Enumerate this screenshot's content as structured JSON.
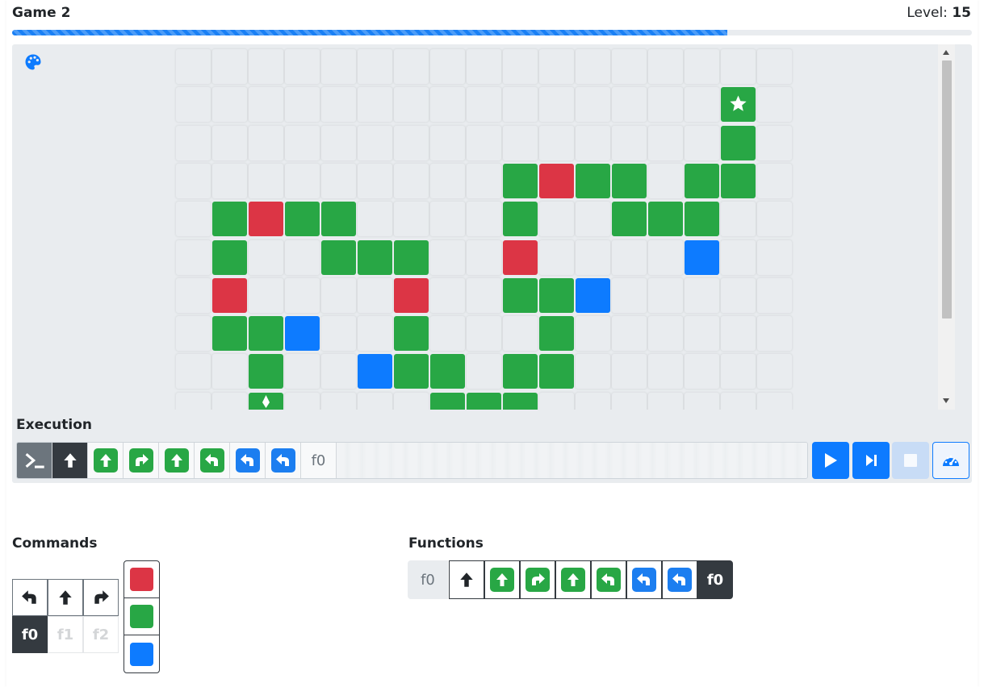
{
  "header": {
    "title": "Game 2",
    "level_label": "Level:",
    "level_value": "15"
  },
  "progress": {
    "fraction": 0.745,
    "color": "#1a80f5"
  },
  "colors": {
    "red": "#dc3545",
    "green": "#28a745",
    "blue": "#0d7bff",
    "empty": "#e9ecef"
  },
  "board": {
    "cols": 17,
    "rows": 10,
    "colored_tiles": [
      {
        "r": 1,
        "c": 15,
        "color": "green",
        "icon": "star"
      },
      {
        "r": 2,
        "c": 15,
        "color": "green"
      },
      {
        "r": 3,
        "c": 9,
        "color": "green"
      },
      {
        "r": 3,
        "c": 10,
        "color": "red"
      },
      {
        "r": 3,
        "c": 11,
        "color": "green"
      },
      {
        "r": 3,
        "c": 12,
        "color": "green"
      },
      {
        "r": 3,
        "c": 14,
        "color": "green"
      },
      {
        "r": 3,
        "c": 15,
        "color": "green"
      },
      {
        "r": 4,
        "c": 1,
        "color": "green"
      },
      {
        "r": 4,
        "c": 2,
        "color": "red"
      },
      {
        "r": 4,
        "c": 3,
        "color": "green"
      },
      {
        "r": 4,
        "c": 4,
        "color": "green"
      },
      {
        "r": 4,
        "c": 9,
        "color": "green"
      },
      {
        "r": 4,
        "c": 12,
        "color": "green"
      },
      {
        "r": 4,
        "c": 13,
        "color": "green"
      },
      {
        "r": 4,
        "c": 14,
        "color": "green"
      },
      {
        "r": 5,
        "c": 1,
        "color": "green"
      },
      {
        "r": 5,
        "c": 4,
        "color": "green"
      },
      {
        "r": 5,
        "c": 5,
        "color": "green"
      },
      {
        "r": 5,
        "c": 6,
        "color": "green"
      },
      {
        "r": 5,
        "c": 9,
        "color": "red"
      },
      {
        "r": 5,
        "c": 14,
        "color": "blue"
      },
      {
        "r": 6,
        "c": 1,
        "color": "red"
      },
      {
        "r": 6,
        "c": 6,
        "color": "red"
      },
      {
        "r": 6,
        "c": 9,
        "color": "green"
      },
      {
        "r": 6,
        "c": 10,
        "color": "green"
      },
      {
        "r": 6,
        "c": 11,
        "color": "blue"
      },
      {
        "r": 7,
        "c": 1,
        "color": "green"
      },
      {
        "r": 7,
        "c": 2,
        "color": "green"
      },
      {
        "r": 7,
        "c": 3,
        "color": "blue"
      },
      {
        "r": 7,
        "c": 6,
        "color": "green"
      },
      {
        "r": 7,
        "c": 10,
        "color": "green"
      },
      {
        "r": 8,
        "c": 2,
        "color": "green"
      },
      {
        "r": 8,
        "c": 5,
        "color": "blue"
      },
      {
        "r": 8,
        "c": 6,
        "color": "green"
      },
      {
        "r": 8,
        "c": 7,
        "color": "green"
      },
      {
        "r": 8,
        "c": 9,
        "color": "green"
      },
      {
        "r": 8,
        "c": 10,
        "color": "green"
      },
      {
        "r": 9,
        "c": 2,
        "color": "green",
        "icon": "robot-arrow"
      },
      {
        "r": 9,
        "c": 7,
        "color": "green"
      },
      {
        "r": 9,
        "c": 8,
        "color": "green"
      },
      {
        "r": 9,
        "c": 9,
        "color": "green"
      }
    ]
  },
  "execution": {
    "label": "Execution",
    "steps": [
      {
        "icon": "terminal-icon",
        "style": "term"
      },
      {
        "icon": "arrow-up-icon",
        "style": "dark"
      },
      {
        "icon": "arrow-up-icon",
        "style": "green"
      },
      {
        "icon": "turn-right-icon",
        "style": "green"
      },
      {
        "icon": "arrow-up-icon",
        "style": "green"
      },
      {
        "icon": "turn-left-icon",
        "style": "green"
      },
      {
        "icon": "turn-left-icon",
        "style": "blue"
      },
      {
        "icon": "turn-left-icon",
        "style": "blue"
      },
      {
        "label": "f0",
        "style": "fn"
      }
    ],
    "controls": [
      "play-icon",
      "step-forward-icon",
      "stop-icon",
      "speed-icon"
    ]
  },
  "commands": {
    "label": "Commands",
    "moves": [
      "turn-left-icon",
      "arrow-up-icon",
      "turn-right-icon"
    ],
    "functions": [
      {
        "label": "f0",
        "state": "active"
      },
      {
        "label": "f1",
        "state": "disabled"
      },
      {
        "label": "f2",
        "state": "disabled"
      }
    ],
    "colors": [
      "red",
      "green",
      "blue"
    ]
  },
  "functions": {
    "label": "Functions",
    "name": "f0",
    "steps": [
      {
        "icon": "arrow-up-icon",
        "style": "plain"
      },
      {
        "icon": "arrow-up-icon",
        "style": "green"
      },
      {
        "icon": "turn-right-icon",
        "style": "green"
      },
      {
        "icon": "arrow-up-icon",
        "style": "green"
      },
      {
        "icon": "turn-left-icon",
        "style": "green"
      },
      {
        "icon": "turn-left-icon",
        "style": "blue"
      },
      {
        "icon": "turn-left-icon",
        "style": "blue"
      },
      {
        "label": "f0",
        "style": "active"
      }
    ]
  }
}
